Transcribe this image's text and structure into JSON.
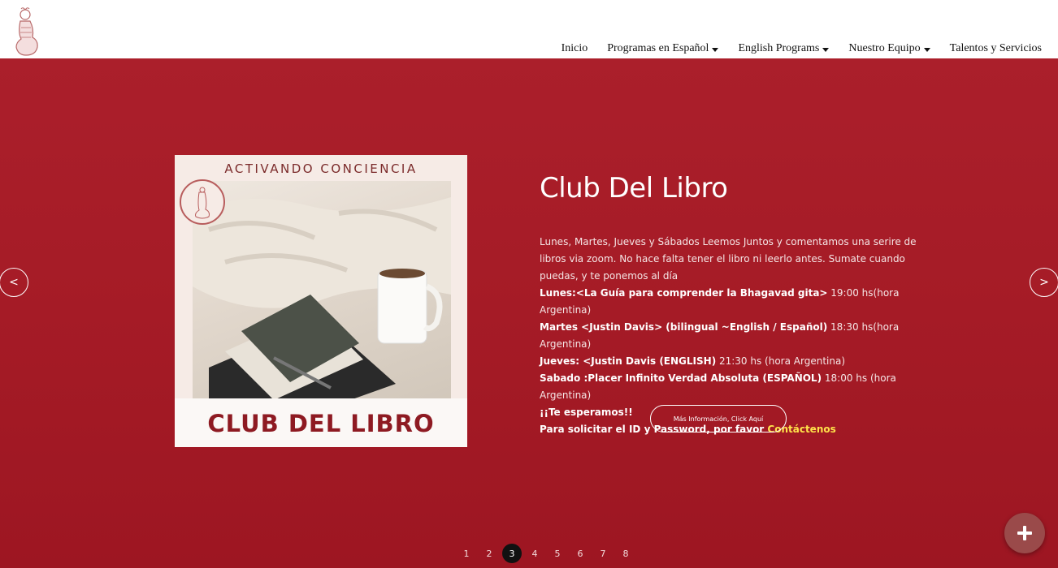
{
  "nav": {
    "items": [
      {
        "label": "Inicio",
        "dropdown": false
      },
      {
        "label": "Programas en Español",
        "dropdown": true
      },
      {
        "label": "English Programs",
        "dropdown": true
      },
      {
        "label": "Nuestro Equipo",
        "dropdown": true
      },
      {
        "label": "Talentos y Servicios",
        "dropdown": false
      }
    ]
  },
  "slide": {
    "poster_top_text": "ACTIVANDO CONCIENCIA",
    "poster_title": "CLUB DEL LIBRO",
    "seal_text": "Activando Conciencia",
    "title": "Club Del Libro",
    "description": "Lunes, Martes, Jueves y Sábados Leemos Juntos y comentamos una serire de libros via zoom. No hace falta tener el libro ni leerlo antes. Sumate cuando puedas, y te ponemos al día",
    "schedule": [
      {
        "bold": "Lunes:<La Guía para comprender la Bhagavad gita>",
        "rest": " 19:00 hs(hora Argentina)"
      },
      {
        "bold": "Martes <Justin Davis> (bilingual ~English / Español)",
        "rest": " 18:30 hs(hora Argentina)"
      },
      {
        "bold": "Jueves: <Justin Davis (ENGLISH)",
        "rest": " 21:30 hs (hora Argentina)"
      },
      {
        "bold": "Sabado :Placer Infinito Verdad Absoluta (ESPAÑOL)",
        "rest": " 18:00 hs (hora Argentina)"
      }
    ],
    "closing": "¡¡Te esperamos!!",
    "contact_prefix": "Para solicitar el ID y Password, por favor ",
    "contact_link": "Contáctenos",
    "more_button": "Más Información, Click Aquí"
  },
  "carousel": {
    "prev_label": "<",
    "next_label": ">",
    "pages": [
      "1",
      "2",
      "3",
      "4",
      "5",
      "6",
      "7",
      "8"
    ],
    "active_page": "3"
  },
  "colors": {
    "hero_bg": "#a51b26",
    "link": "#ffe34a",
    "fab": "#9a4a4a"
  },
  "icons": {
    "fab": "plus-icon",
    "logo": "hand-logo-icon"
  }
}
